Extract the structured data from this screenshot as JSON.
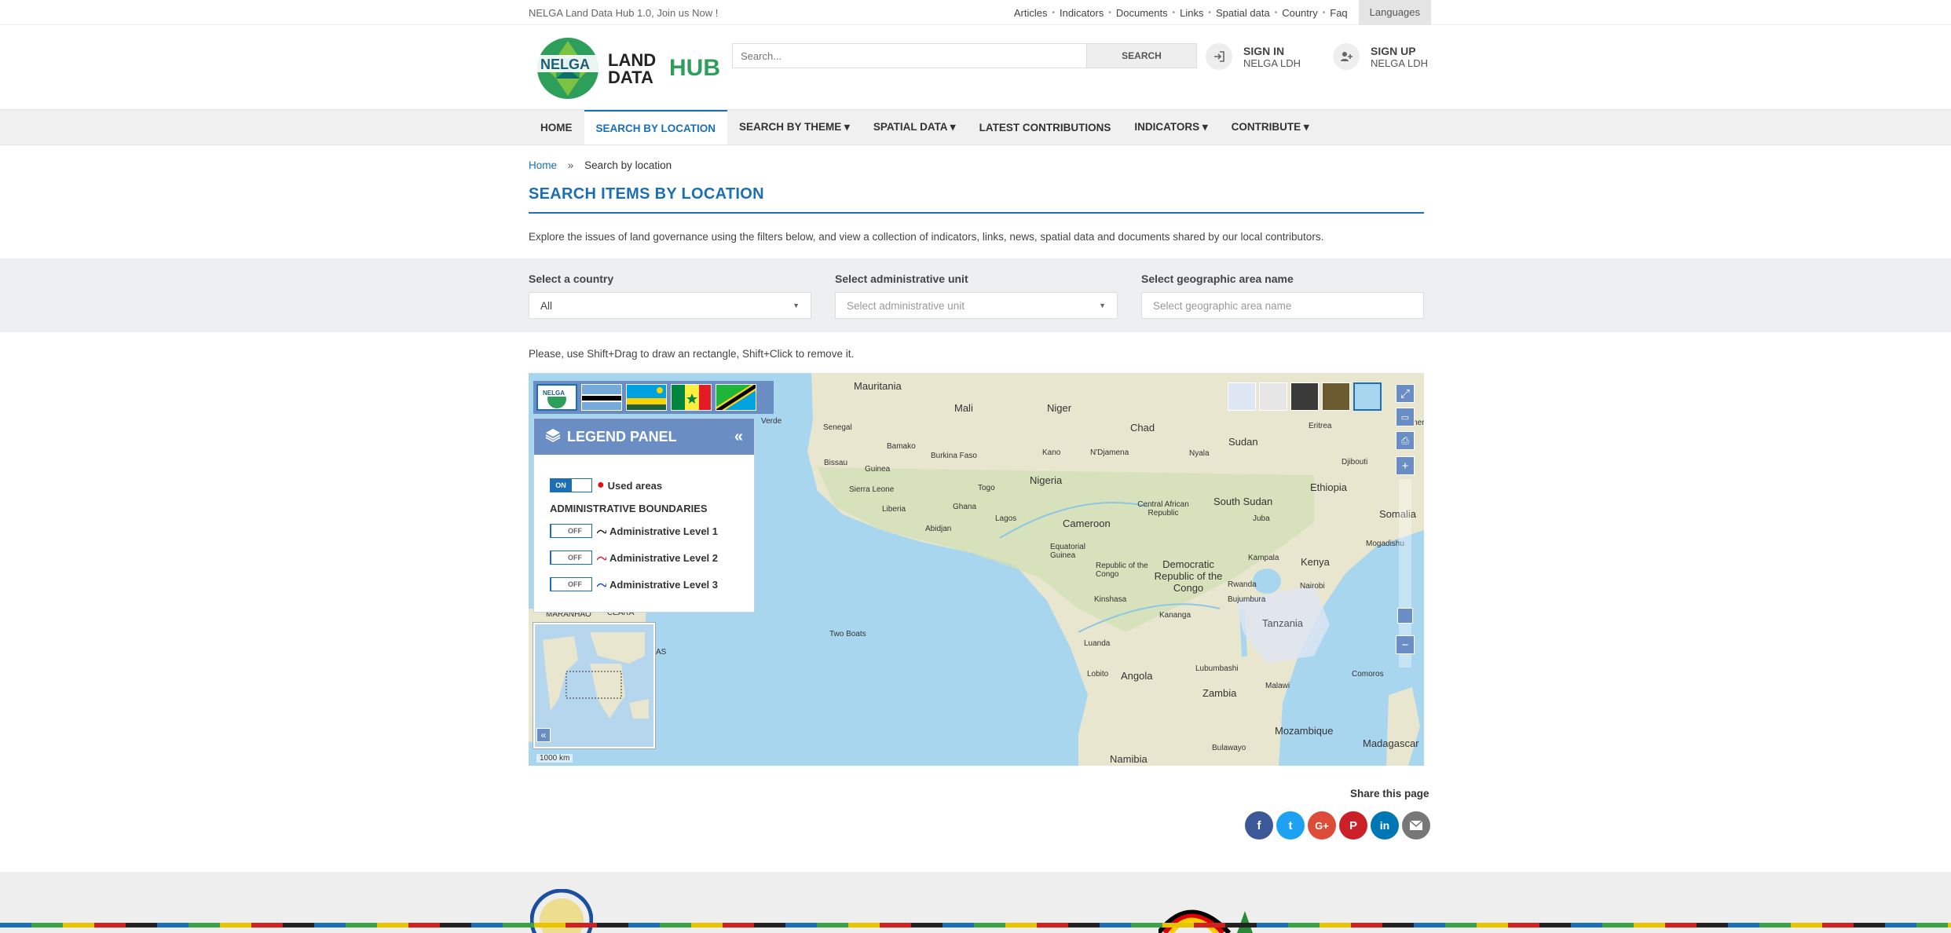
{
  "topbar": {
    "tagline": "NELGA Land Data Hub 1.0, Join us Now !",
    "links": [
      "Articles",
      "Indicators",
      "Documents",
      "Links",
      "Spatial data",
      "Country",
      "Faq"
    ],
    "languages": "Languages"
  },
  "header": {
    "logo_text_1": "NELGA",
    "logo_text_2": "LAND",
    "logo_text_3": "DATA",
    "logo_text_4": "HUB",
    "search_placeholder": "Search...",
    "search_button": "SEARCH",
    "signin_1": "SIGN IN",
    "signin_2": "NELGA LDH",
    "signup_1": "SIGN UP",
    "signup_2": "NELGA LDH"
  },
  "nav": {
    "items": [
      {
        "label": "HOME"
      },
      {
        "label": "SEARCH BY LOCATION"
      },
      {
        "label": "SEARCH BY THEME ▾"
      },
      {
        "label": "SPATIAL DATA ▾"
      },
      {
        "label": "LATEST CONTRIBUTIONS"
      },
      {
        "label": "INDICATORS ▾"
      },
      {
        "label": "CONTRIBUTE ▾"
      }
    ]
  },
  "breadcrumb": {
    "home": "Home",
    "sep": "»",
    "current": "Search by location"
  },
  "page": {
    "title": "SEARCH ITEMS BY LOCATION",
    "intro": "Explore the issues of land governance using the filters below, and view a collection of indicators, links, news, spatial data and documents shared by our local contributors.",
    "hint": "Please, use Shift+Drag to draw an rectangle, Shift+Click to remove it."
  },
  "filters": {
    "country_label": "Select a country",
    "country_value": "All",
    "admin_label": "Select administrative unit",
    "admin_placeholder": "Select administrative unit",
    "area_label": "Select geographic area name",
    "area_placeholder": "Select geographic area name"
  },
  "map": {
    "legend_title": "LEGEND PANEL",
    "used_areas": "Used areas",
    "on": "ON",
    "off": "OFF",
    "admin_boundaries": "ADMINISTRATIVE BOUNDARIES",
    "level1": "Administrative Level 1",
    "level2": "Administrative Level 2",
    "level3": "Administrative Level 3",
    "scale": "1000 km",
    "flag_nelga": "NELGA",
    "labels": {
      "mauritania": "Mauritania",
      "mali": "Mali",
      "niger": "Niger",
      "chad": "Chad",
      "sudan": "Sudan",
      "eritrea": "Eritrea",
      "yemen": "Yemen",
      "senegal": "Senegal",
      "verde": "Verde",
      "bamako": "Bamako",
      "burkina": "Burkina Faso",
      "kano": "Kano",
      "ndjamena": "N'Djamena",
      "nyala": "Nyala",
      "djibouti": "Djibouti",
      "guinea": "Guinea",
      "bissau": "Bissau",
      "nigeria": "Nigeria",
      "togo": "Togo",
      "ethiopia": "Ethiopia",
      "sierra": "Sierra Leone",
      "ghana": "Ghana",
      "liberia": "Liberia",
      "lagos": "Lagos",
      "car": "Central African Republic",
      "southsudan": "South Sudan",
      "somalia": "Somalia",
      "abidjan": "Abidjan",
      "cameroon": "Cameroon",
      "juba": "Juba",
      "eqguinea": "Equatorial Guinea",
      "mogadishu": "Mogadishu",
      "repcongo": "Republic of the Congo",
      "drc": "Democratic Republic of the Congo",
      "kampala": "Kampala",
      "kenya": "Kenya",
      "nairobi": "Nairobi",
      "kinshasa": "Kinshasa",
      "kananga": "Kananga",
      "tanzania": "Tanzania",
      "bujumbura": "Bujumbura",
      "rwanda": "Rwanda",
      "maranhao": "MARANHÃO",
      "ceara": "CEARÁ",
      "twoboats": "Two Boats",
      "luanda": "Luanda",
      "angola": "Angola",
      "lobito": "Lobito",
      "lubumbashi": "Lubumbashi",
      "malawi": "Malawi",
      "comoros": "Comoros",
      "zambia": "Zambia",
      "mozambique": "Mozambique",
      "namibia": "Namibia",
      "bulawayo": "Bulawayo",
      "madagascar": "Madagascar",
      "as": "AS"
    }
  },
  "share": {
    "label": "Share this page"
  },
  "colors": {
    "accent": "#1a6fb6",
    "panel": "#6a8ec4",
    "ocean": "#a9d6ef",
    "land": "#e9e6cf"
  }
}
